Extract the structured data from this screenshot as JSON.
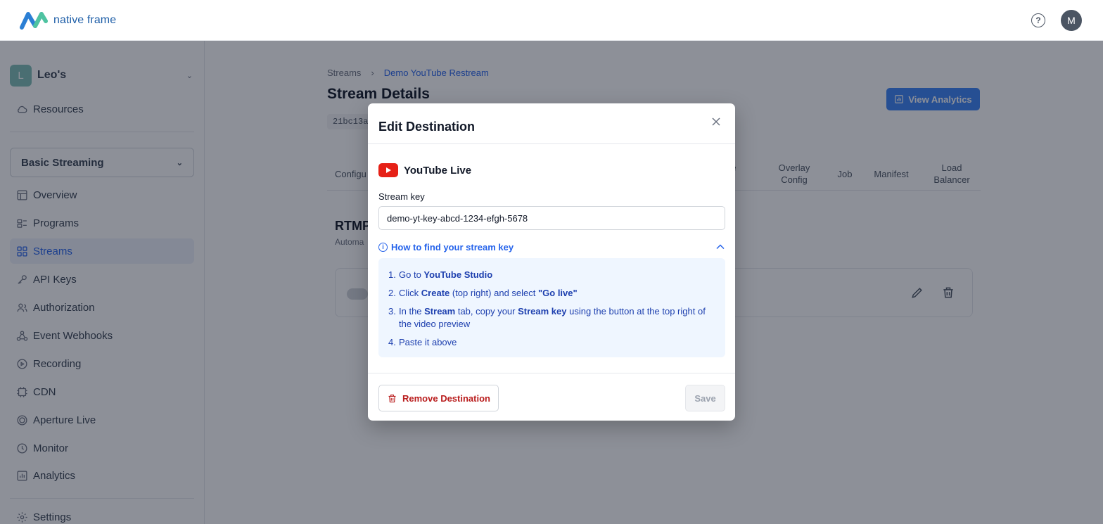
{
  "header": {
    "logo_text": "native frame",
    "user_initial": "M"
  },
  "sidebar": {
    "org_initial": "L",
    "org_name": "Leo's",
    "resources_label": "Resources",
    "plan_select": "Basic Streaming",
    "items": [
      {
        "label": "Overview",
        "icon": "layout-icon"
      },
      {
        "label": "Programs",
        "icon": "programs-icon"
      },
      {
        "label": "Streams",
        "icon": "grid-icon",
        "active": true
      },
      {
        "label": "API Keys",
        "icon": "key-icon"
      },
      {
        "label": "Authorization",
        "icon": "users-icon"
      },
      {
        "label": "Event Webhooks",
        "icon": "webhook-icon"
      },
      {
        "label": "Recording",
        "icon": "record-icon"
      },
      {
        "label": "CDN",
        "icon": "cdn-icon"
      },
      {
        "label": "Aperture Live",
        "icon": "aperture-icon"
      },
      {
        "label": "Monitor",
        "icon": "clock-icon"
      },
      {
        "label": "Analytics",
        "icon": "chart-icon"
      }
    ],
    "settings_label": "Settings"
  },
  "main": {
    "breadcrumb": [
      "Streams",
      "Demo YouTube Restream"
    ],
    "title": "Stream Details",
    "stream_id": "21bc13a",
    "view_analytics": "View Analytics",
    "tabs": [
      "Configu",
      "ive\ng",
      "Overlay\nConfig",
      "Job",
      "Manifest",
      "Load\nBalancer"
    ],
    "section_title": "RTMP",
    "section_sub": "Automa"
  },
  "modal": {
    "title": "Edit Destination",
    "platform": "YouTube Live",
    "stream_key_label": "Stream key",
    "stream_key_value": "demo-yt-key-abcd-1234-efgh-5678",
    "howto_label": "How to find your stream key",
    "steps": [
      {
        "num": "1.",
        "parts": [
          [
            "Go to ",
            false
          ],
          [
            "YouTube Studio",
            true
          ]
        ]
      },
      {
        "num": "2.",
        "parts": [
          [
            "Click ",
            false
          ],
          [
            "Create",
            true
          ],
          [
            " (top right) and select ",
            false
          ],
          [
            "\"Go live\"",
            true
          ]
        ]
      },
      {
        "num": "3.",
        "parts": [
          [
            "In the ",
            false
          ],
          [
            "Stream",
            true
          ],
          [
            " tab, copy your ",
            false
          ],
          [
            "Stream key",
            true
          ],
          [
            " using the button at the top right of the video preview",
            false
          ]
        ]
      },
      {
        "num": "4.",
        "parts": [
          [
            "Paste it above",
            false
          ]
        ]
      }
    ],
    "remove_label": "Remove Destination",
    "save_label": "Save"
  },
  "colors": {
    "accent": "#2563eb",
    "danger": "#b91c1c",
    "youtube": "#e62117",
    "overlay": "rgba(17,24,39,0.48)"
  }
}
